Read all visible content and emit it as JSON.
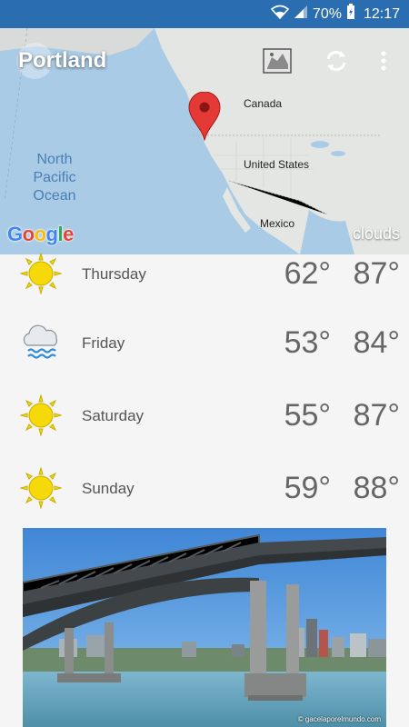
{
  "status": {
    "battery": "70%",
    "time": "12:17"
  },
  "header": {
    "city": "Portland"
  },
  "map": {
    "labels": {
      "canada": "Canada",
      "us": "United States",
      "mexico": "Mexico",
      "ocean_line1": "North",
      "ocean_line2": "Pacific",
      "ocean_line3": "Ocean"
    },
    "brand": "Google",
    "condition": "clouds"
  },
  "forecast": [
    {
      "day": "Thursday",
      "low": "62°",
      "high": "87°",
      "icon": "sun-icon"
    },
    {
      "day": "Friday",
      "low": "53°",
      "high": "84°",
      "icon": "rain-cloud-icon"
    },
    {
      "day": "Saturday",
      "low": "55°",
      "high": "87°",
      "icon": "sun-icon"
    },
    {
      "day": "Sunday",
      "low": "59°",
      "high": "88°",
      "icon": "sun-icon"
    }
  ],
  "photo": {
    "credit": "© gacelaporelmundo.com"
  },
  "colors": {
    "status_bar": "#2a6db0",
    "pin": "#e53935",
    "sun": "#f5d90a"
  }
}
